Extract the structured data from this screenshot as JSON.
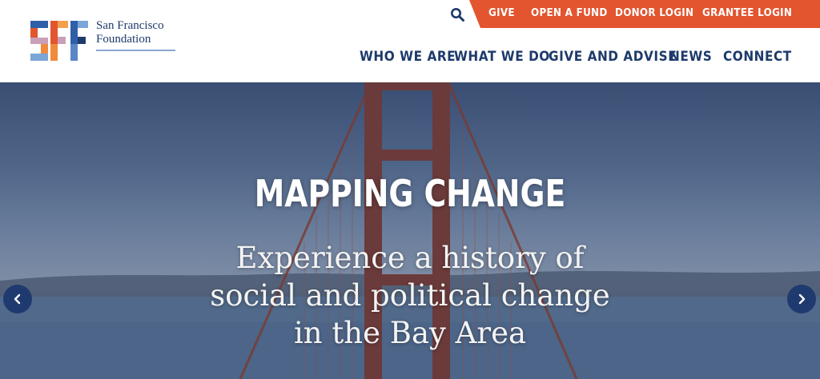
{
  "logo": {
    "line1": "San Francisco",
    "line2": "Foundation",
    "mark_letters": "SFF"
  },
  "utility_nav": {
    "search_icon": "search-icon",
    "items": [
      "GIVE",
      "OPEN A FUND",
      "DONOR LOGIN",
      "GRANTEE LOGIN"
    ]
  },
  "main_nav": {
    "items": [
      "WHO WE ARE",
      "WHAT WE DO",
      "GIVE AND ADVISE",
      "NEWS",
      "CONNECT"
    ]
  },
  "hero": {
    "title": "MAPPING CHANGE",
    "subtitle_lines": [
      "Experience a history of",
      "social and political change",
      "in the Bay Area"
    ],
    "prev_icon": "chevron-left-icon",
    "next_icon": "chevron-right-icon"
  },
  "colors": {
    "navy": "#1d3a6b",
    "orange": "#e2552f",
    "arrow_bg": "#1f3a6e"
  }
}
